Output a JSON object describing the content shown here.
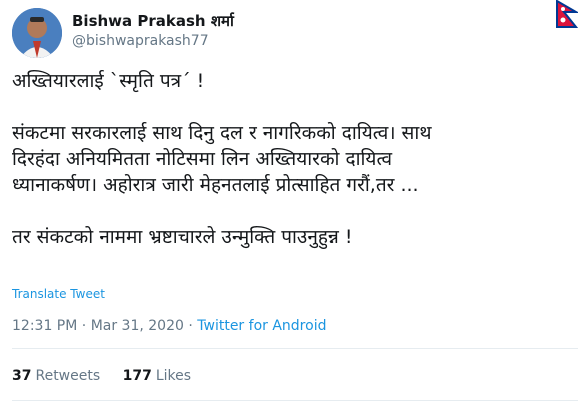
{
  "author": {
    "name": "Bishwa Prakash शर्मा",
    "handle": "@bishwaprakash77"
  },
  "tweet": {
    "text": "अख्तियारलाई `स्मृति पत्र´ !\n\nसंकटमा सरकारलाई साथ दिनु दल र नागरिकको दायित्व। साथ\nदिरहंदा अनियमितता नोटिसमा लिन अख्तियारको दायित्व\nध्यानाकर्षण। अहोरात्र जारी मेहनतलाई प्रोत्साहित गरौं,तर ...\n\nतर संकटको नाममा भ्रष्टाचारले उन्मुक्ति पाउनुहुन्न !",
    "translate_label": "Translate Tweet"
  },
  "meta": {
    "time": "12:31 PM",
    "sep1": " · ",
    "date": "Mar 31, 2020",
    "sep2": " · ",
    "source": "Twitter for Android"
  },
  "stats": {
    "retweets_count": "37",
    "retweets_label": "Retweets",
    "likes_count": "177",
    "likes_label": "Likes"
  },
  "colors": {
    "link": "#1b95e0",
    "muted": "#657786",
    "divider": "#e6ecf0"
  }
}
